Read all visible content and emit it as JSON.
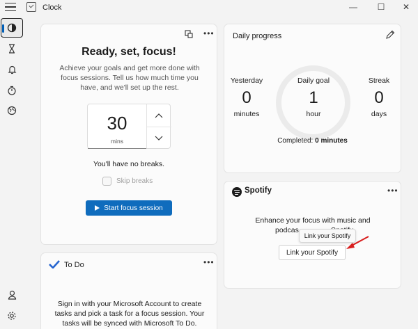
{
  "window": {
    "title": "Clock",
    "minimize": "—",
    "maximize": "☐",
    "close": "✕"
  },
  "nav": {
    "items": [
      {
        "icon": "focus-sessions-icon",
        "active": true
      },
      {
        "icon": "timer-icon"
      },
      {
        "icon": "alarm-icon"
      },
      {
        "icon": "stopwatch-icon"
      },
      {
        "icon": "world-clock-icon"
      }
    ],
    "bottom": [
      {
        "icon": "account-icon"
      },
      {
        "icon": "settings-icon"
      }
    ]
  },
  "focus": {
    "title": "Ready, set, focus!",
    "description": "Achieve your goals and get more done with focus sessions. Tell us how much time you have, and we'll set up the rest.",
    "minutes_value": "30",
    "minutes_unit": "mins",
    "breaks_note": "You'll have no breaks.",
    "skip_breaks_label": "Skip breaks",
    "start_button": "Start focus session"
  },
  "todo": {
    "title": "To Do",
    "description": "Sign in with your Microsoft Account to create tasks and pick a task for a focus session. Your tasks will be synced with Microsoft To Do."
  },
  "daily_progress": {
    "title": "Daily progress",
    "yesterday": {
      "label": "Yesterday",
      "value": "0",
      "unit": "minutes"
    },
    "goal": {
      "label": "Daily goal",
      "value": "1",
      "unit": "hour"
    },
    "streak": {
      "label": "Streak",
      "value": "0",
      "unit": "days"
    },
    "completed_label": "Completed:",
    "completed_value": "0 minutes"
  },
  "spotify": {
    "name": "Spotify",
    "description_line1": "Enhance your focus with music and",
    "description_line2": "podcas",
    "description_line2_tail": "Spotify",
    "tooltip": "Link your Spotify",
    "link_button": "Link your Spotify"
  },
  "colors": {
    "accent": "#0f6cbd",
    "annotation_arrow": "#d81e1e"
  }
}
